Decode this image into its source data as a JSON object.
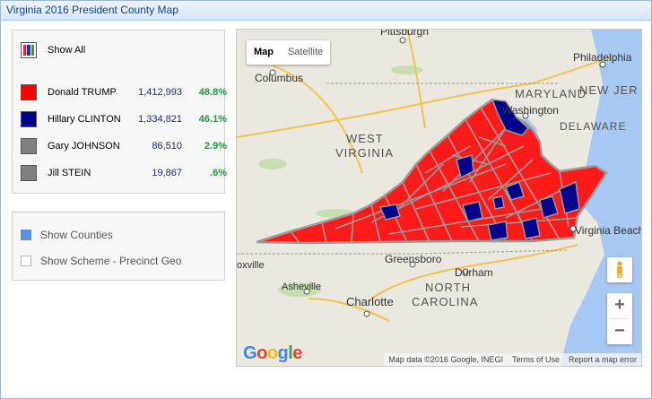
{
  "window": {
    "title": "Virginia 2016 President  County Map"
  },
  "legend": {
    "show_all_label": "Show All",
    "show_all_colors": [
      "#e8212b",
      "#1a3aa8",
      "#2aa03a"
    ],
    "candidates": [
      {
        "name": "Donald TRUMP",
        "votes": "1,412,993",
        "pct": "48.8%",
        "color": "#ff0000"
      },
      {
        "name": "Hillary CLINTON",
        "votes": "1,334,821",
        "pct": "46.1%",
        "color": "#00008b"
      },
      {
        "name": "Gary JOHNSON",
        "votes": "86,510",
        "pct": "2.9%",
        "color": "#808080"
      },
      {
        "name": "Jill STEIN",
        "votes": "19,867",
        "pct": ".6%",
        "color": "#808080"
      }
    ]
  },
  "options": {
    "show_counties": {
      "label": "Show Counties",
      "checked": true
    },
    "show_scheme": {
      "label": "Show Scheme - Precinct Geo",
      "checked": false
    }
  },
  "map": {
    "type_map": "Map",
    "type_satellite": "Satellite",
    "zoom_in": "+",
    "zoom_out": "−",
    "google_logo": [
      "G",
      "o",
      "o",
      "g",
      "l",
      "e"
    ],
    "google_colors": [
      "#4285f4",
      "#ea4335",
      "#fbbc05",
      "#4285f4",
      "#34a853",
      "#ea4335"
    ],
    "attribution": "Map data ©2016 Google, INEGI",
    "terms": "Terms of Use",
    "report": "Report a map error",
    "labels": {
      "pittsburgh": "Pittsburgh",
      "philadelphia": "Philadelphia",
      "columbus": "Columbus",
      "maryland": "MARYLAND",
      "new_jersey": "NEW JER",
      "washington": "Washington",
      "delaware": "DELAWARE",
      "west": "WEST",
      "virginia_state": "VIRGINIA",
      "virginia_beach": "Virginia Beach",
      "greensboro": "Greensboro",
      "durham": "Durham",
      "asheville": "Asheville",
      "north": "NORTH",
      "carolina": "CAROLINA",
      "charlotte": "Charlotte",
      "knoxville": "oxville"
    },
    "state_fill": "#ff1a1a",
    "county_stroke": "#9a9a9a",
    "dem_fill": "#00008b"
  }
}
